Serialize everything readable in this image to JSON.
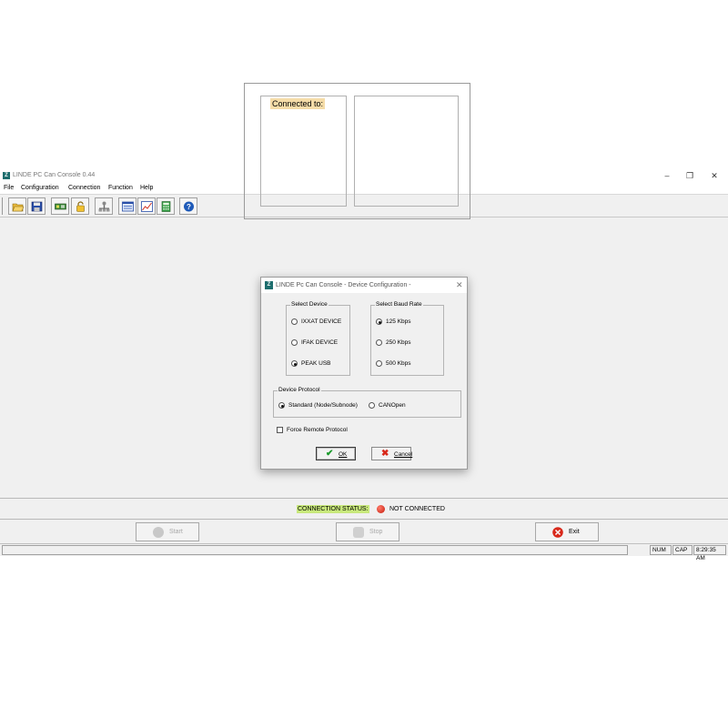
{
  "window": {
    "title": "LINDE PC Can Console 0.44",
    "controls": [
      "minimize-icon",
      "maximize-icon",
      "close-icon"
    ]
  },
  "menu": [
    "File",
    "Configuration",
    "Connection",
    "Function",
    "Help"
  ],
  "toolbar": {
    "buttons": [
      "open-folder-icon",
      "save-disk-icon",
      "can-interface-icon",
      "unlock-icon",
      "network-icon",
      "monitor-window-icon",
      "chart-icon",
      "calculator-icon",
      "help-icon"
    ]
  },
  "main": {
    "connected_label": "Connected to:"
  },
  "dialog": {
    "title": "LINDE Pc Can Console - Device Configuration -",
    "select_device": {
      "title": "Select Device",
      "options": [
        "IXXAT DEVICE",
        "IFAK  DEVICE",
        "PEAK USB"
      ],
      "selected": "PEAK USB"
    },
    "baud_rate": {
      "title": "Select Baud Rate",
      "options": [
        "125 Kbps",
        "250 Kbps",
        "500 Kbps"
      ],
      "selected": "125 Kbps"
    },
    "protocol": {
      "title": "Device Protocol",
      "options": [
        "Standard (Node/Subnode)",
        "CANOpen"
      ],
      "selected": "Standard (Node/Subnode)"
    },
    "force_remote": {
      "label": "Force Remote Protocol",
      "checked": false
    },
    "ok_label": "OK",
    "cancel_label": "Cancel"
  },
  "status": {
    "label": "CONNECTION STATUS:",
    "value": "NOT CONNECTED",
    "led_color": "#d8281a"
  },
  "actions": {
    "start_label": "Start",
    "stop_label": "Stop",
    "exit_label": "Exit"
  },
  "statusbar": {
    "num": "NUM",
    "cap": "CAP",
    "time": "8:29:35 AM"
  }
}
